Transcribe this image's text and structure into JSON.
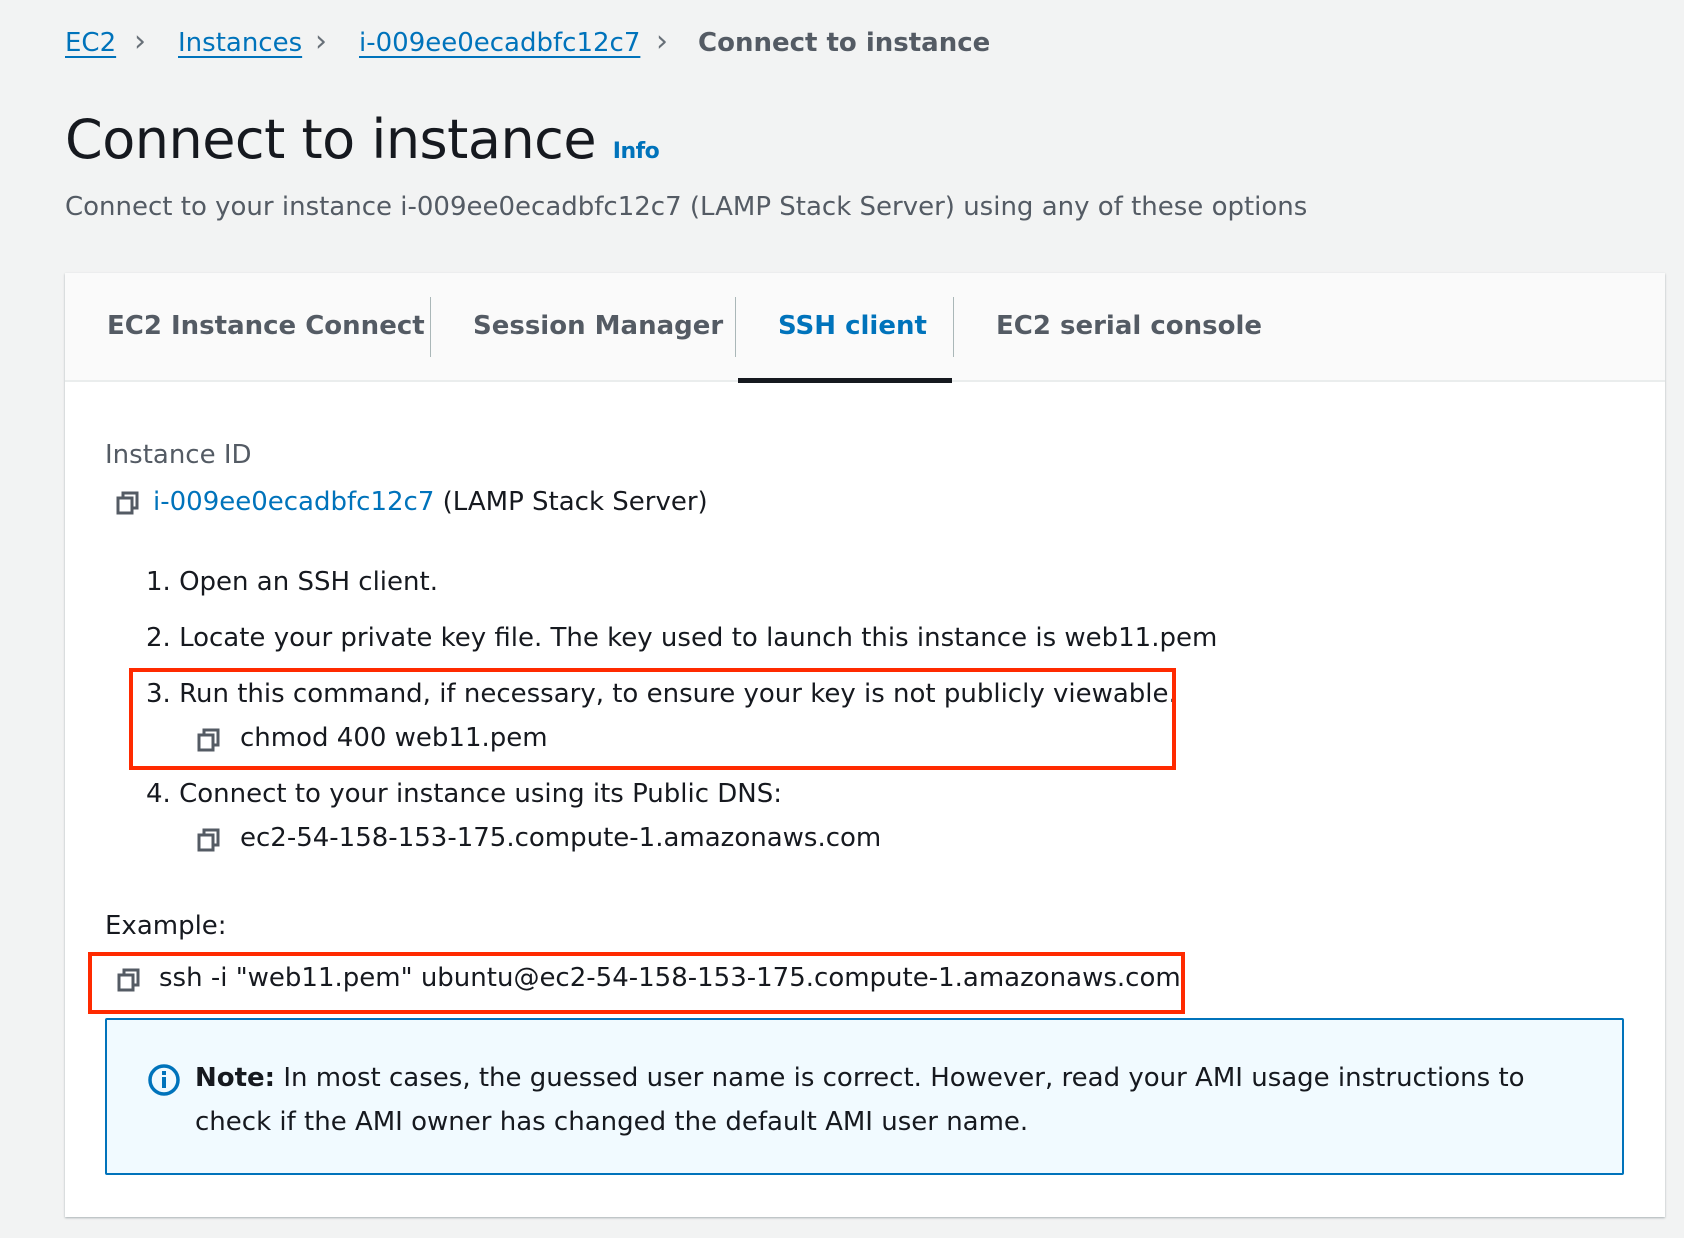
{
  "breadcrumb": {
    "items": [
      "EC2",
      "Instances",
      "i-009ee0ecadbfc12c7"
    ],
    "current": "Connect to instance"
  },
  "header": {
    "title": "Connect to instance",
    "info_link": "Info",
    "subtitle": "Connect to your instance i-009ee0ecadbfc12c7 (LAMP Stack Server) using any of these options"
  },
  "tabs": [
    {
      "label": "EC2 Instance Connect"
    },
    {
      "label": "Session Manager"
    },
    {
      "label": "SSH client",
      "selected": true
    },
    {
      "label": "EC2 serial console"
    }
  ],
  "ssh": {
    "instance_id_label": "Instance ID",
    "instance_id": "i-009ee0ecadbfc12c7",
    "instance_name": "(LAMP Stack Server)",
    "steps": [
      {
        "num": "1.",
        "text": "Open an SSH client."
      },
      {
        "num": "2.",
        "text": "Locate your private key file. The key used to launch this instance is web11.pem"
      },
      {
        "num": "3.",
        "text": "Run this command, if necessary, to ensure your key is not publicly viewable.",
        "command": "chmod 400 web11.pem"
      },
      {
        "num": "4.",
        "text": "Connect to your instance using its Public DNS:",
        "command": "ec2-54-158-153-175.compute-1.amazonaws.com"
      }
    ],
    "example_label": "Example:",
    "example_command": "ssh -i \"web11.pem\" ubuntu@ec2-54-158-153-175.compute-1.amazonaws.com"
  },
  "note": {
    "label": "Note:",
    "text": " In most cases, the guessed user name is correct. However, read your AMI usage instructions to check if the AMI owner has changed the default AMI user name."
  },
  "colors": {
    "link": "#0073bb",
    "highlight": "#ff2a00",
    "note_bg": "#f1faff"
  }
}
